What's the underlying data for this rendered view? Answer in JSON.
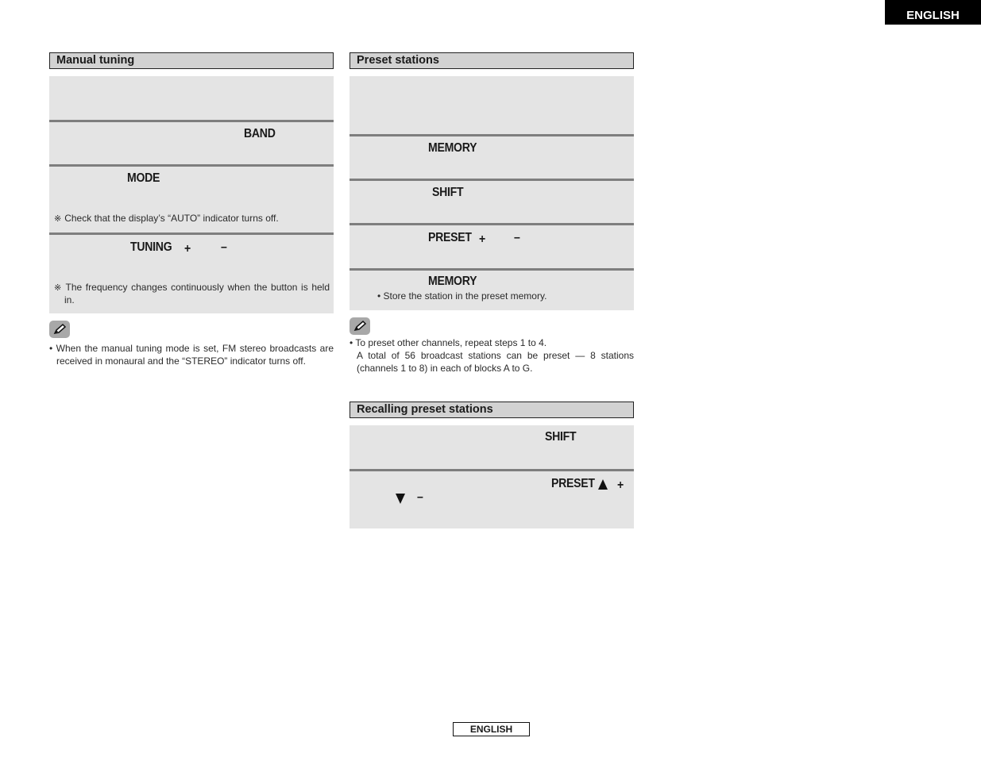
{
  "header": {
    "language_tab": "ENGLISH"
  },
  "footer": {
    "language_label": "ENGLISH"
  },
  "manual_tuning": {
    "title": "Manual tuning",
    "steps": [
      {
        "key": ""
      },
      {
        "key": "BAND"
      },
      {
        "key": "MODE",
        "note_mark": "※",
        "note": "Check that the display’s “AUTO” indicator turns off."
      },
      {
        "key": "TUNING",
        "plus": "+",
        "minus": "–",
        "note_mark": "※",
        "note": "The frequency changes continuously when the button is held in."
      }
    ],
    "tip_icon": "pencil-icon",
    "tip": "• When the manual tuning mode is set, FM stereo broadcasts are received in monaural and the “STEREO” indicator turns off."
  },
  "preset_stations": {
    "title": "Preset stations",
    "steps": [
      {
        "key": ""
      },
      {
        "key": "MEMORY"
      },
      {
        "key": "SHIFT"
      },
      {
        "key": "PRESET",
        "plus": "+",
        "minus": "–"
      },
      {
        "key": "MEMORY",
        "bullet": "• Store the station in the preset memory."
      }
    ],
    "tip_icon": "pencil-icon",
    "tip_line1": "• To preset other channels, repeat steps 1 to 4.",
    "tip_line2": "A total of 56 broadcast stations can be preset — 8 stations (channels 1 to 8) in each of blocks A to G."
  },
  "recalling_preset_stations": {
    "title": "Recalling preset stations",
    "steps": [
      {
        "key": "SHIFT"
      },
      {
        "key": "PRESET",
        "up_symbol": "▲",
        "plus": "+",
        "down_symbol": "▼",
        "minus": "–"
      }
    ]
  }
}
